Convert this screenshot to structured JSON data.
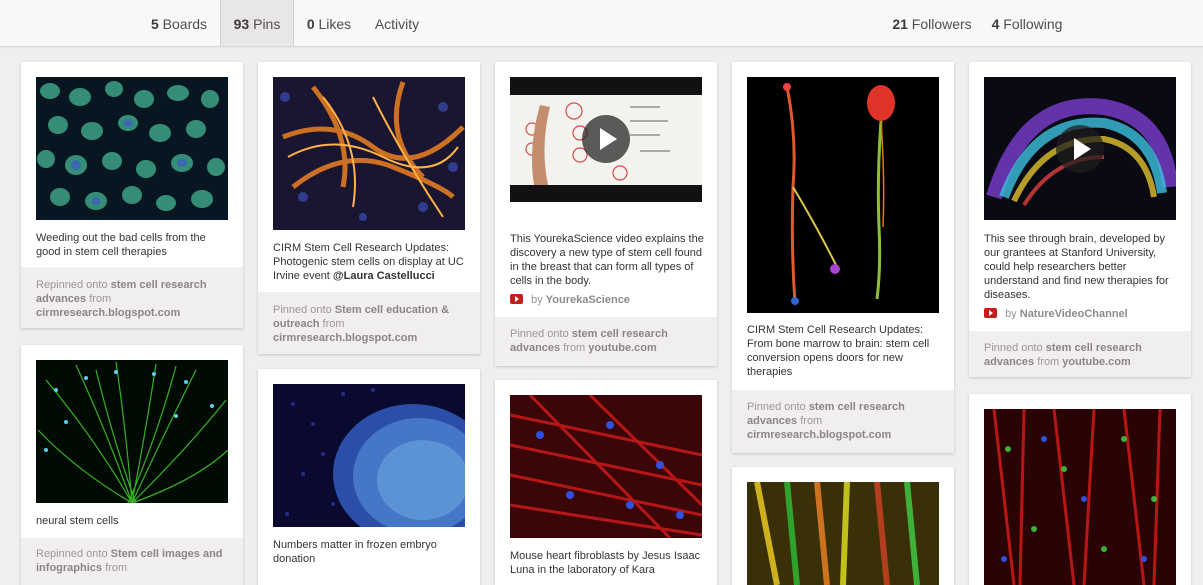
{
  "nav": {
    "boards": {
      "count": "5",
      "label": "Boards"
    },
    "pins": {
      "count": "93",
      "label": "Pins"
    },
    "likes": {
      "count": "0",
      "label": "Likes"
    },
    "activity": {
      "label": "Activity"
    },
    "followers": {
      "count": "21",
      "label": "Followers"
    },
    "following": {
      "count": "4",
      "label": "Following"
    }
  },
  "pins": [
    {
      "desc": "Weeding out the bad cells from the good in stem cell therapies",
      "action": "Repinned onto",
      "board": "stem cell research advances",
      "from": "from",
      "source": "cirmresearch.blogspot.com"
    },
    {
      "desc_pre": "CIRM Stem Cell Research Updates: Photogenic stem cells on display at UC Irvine event ",
      "desc_mention": "@Laura Castellucci",
      "action": "Pinned onto",
      "board": "Stem cell education & outreach",
      "from": "from",
      "source": "cirmresearch.blogspot.com"
    },
    {
      "desc": "This YourekaScience video explains the discovery a new type of stem cell found in the breast that can form all types of cells in the body.",
      "by": "by",
      "credit": "YourekaScience",
      "action": "Pinned onto",
      "board": "stem cell research advances",
      "from": "from",
      "source": "youtube.com"
    },
    {
      "desc": "CIRM Stem Cell Research Updates: From bone marrow to brain: stem cell conversion opens doors for new therapies",
      "action": "Pinned onto",
      "board": "stem cell research advances",
      "from": "from",
      "source": "cirmresearch.blogspot.com"
    },
    {
      "desc": "This see through brain, developed by our grantees at Stanford University, could help researchers better understand and find new therapies for diseases.",
      "by": "by",
      "credit": "NatureVideoChannel",
      "action": "Pinned onto",
      "board": "stem cell research advances",
      "from": "from",
      "source": "youtube.com"
    },
    {
      "desc": "neural stem cells",
      "action": "Repinned onto",
      "board": "Stem cell images and infographics",
      "from": "from"
    },
    {
      "desc": "Numbers matter in frozen embryo donation"
    },
    {
      "desc": "Mouse heart fibroblasts by Jesus Isaac Luna in the laboratory of Kara"
    }
  ],
  "colors": {
    "background": "#f1efee",
    "card": "#ffffff",
    "footer": "#f0eeee",
    "youtube": "#c21e1e"
  }
}
